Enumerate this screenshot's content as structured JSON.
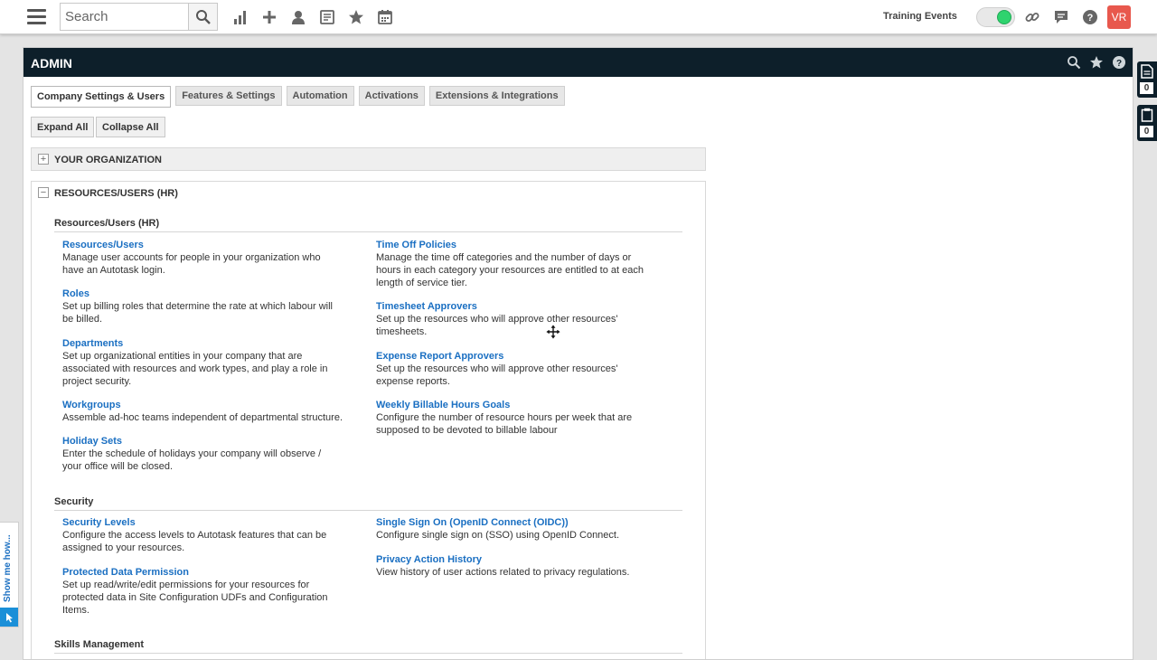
{
  "topbar": {
    "search_placeholder": "Search",
    "training_label": "Training Events",
    "avatar_initials": "VR",
    "icons": [
      "menu-icon",
      "search-icon",
      "reports-icon",
      "add-icon",
      "user-icon",
      "timesheet-icon",
      "favorites-icon",
      "calendar-icon",
      "link-icon",
      "chat-icon",
      "help-icon"
    ]
  },
  "admin": {
    "title": "ADMIN",
    "tabs": [
      "Company Settings & Users",
      "Features & Settings",
      "Automation",
      "Activations",
      "Extensions & Integrations"
    ],
    "expand_all": "Expand All",
    "collapse_all": "Collapse All",
    "sections": {
      "org": {
        "title": "YOUR ORGANIZATION",
        "expander": "+"
      },
      "hr": {
        "title": "RESOURCES/USERS (HR)",
        "expander": "−"
      }
    },
    "groups": {
      "resources": {
        "title": "Resources/Users (HR)",
        "left": [
          {
            "label": "Resources/Users",
            "desc": "Manage user accounts for people in your organization who have an Autotask login."
          },
          {
            "label": "Roles",
            "desc": "Set up billing roles that determine the rate at which labour will be billed."
          },
          {
            "label": "Departments",
            "desc": "Set up organizational entities in your company that are associated with resources and work types, and play a role in project security."
          },
          {
            "label": "Workgroups",
            "desc": "Assemble ad-hoc teams independent of departmental structure."
          },
          {
            "label": "Holiday Sets",
            "desc": "Enter the schedule of holidays your company will observe / your office will be closed."
          }
        ],
        "right": [
          {
            "label": "Time Off Policies",
            "desc": "Manage the time off categories and the number of days or hours in each category your resources are entitled to at each length of service tier."
          },
          {
            "label": "Timesheet Approvers",
            "desc": "Set up the resources who will approve other resources' timesheets."
          },
          {
            "label": "Expense Report Approvers",
            "desc": "Set up the resources who will approve other resources' expense reports."
          },
          {
            "label": "Weekly Billable Hours Goals",
            "desc": "Configure the number of resource hours per week that are supposed to be devoted to billable labour"
          }
        ]
      },
      "security": {
        "title": "Security",
        "left": [
          {
            "label": "Security Levels",
            "desc": "Configure the access levels to Autotask features that can be assigned to your resources."
          },
          {
            "label": "Protected Data Permission",
            "desc": "Set up read/write/edit permissions for your resources for protected data in Site Configuration UDFs and Configuration Items."
          }
        ],
        "right": [
          {
            "label": "Single Sign On (OpenID Connect (OIDC))",
            "desc": "Configure single sign on (SSO) using OpenID Connect."
          },
          {
            "label": "Privacy Action History",
            "desc": "View history of user actions related to privacy regulations."
          }
        ]
      },
      "skills": {
        "title": "Skills Management"
      }
    }
  },
  "side_tools": [
    {
      "icon": "document-icon",
      "count": "0"
    },
    {
      "icon": "clipboard-icon",
      "count": "0"
    }
  ],
  "showme": {
    "label": "Show me how..."
  }
}
